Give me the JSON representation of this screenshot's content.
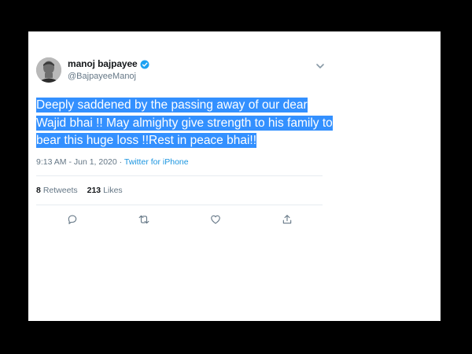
{
  "tweet": {
    "display_name": "manoj bajpayee",
    "handle": "@BajpayeeManoj",
    "text_lines": [
      "Deeply saddened by the passing away of our dear",
      "Wajid bhai !! May almighty give strength to his family to",
      "bear this huge loss !!Rest in peace bhai!!"
    ],
    "timestamp": "9:13 AM - Jun 1, 2020 · ",
    "source": "Twitter for iPhone",
    "retweets": {
      "count": "8",
      "label": "Retweets"
    },
    "likes": {
      "count": "213",
      "label": "Likes"
    }
  },
  "icons": {
    "verified": "verified-badge-icon",
    "caret": "chevron-down-icon",
    "reply": "reply-icon",
    "retweet": "retweet-icon",
    "like": "heart-icon",
    "share": "share-icon"
  },
  "colors": {
    "selection": "#3390ff",
    "link": "#1b95e0",
    "verified": "#1da1f2",
    "muted": "#657786"
  }
}
